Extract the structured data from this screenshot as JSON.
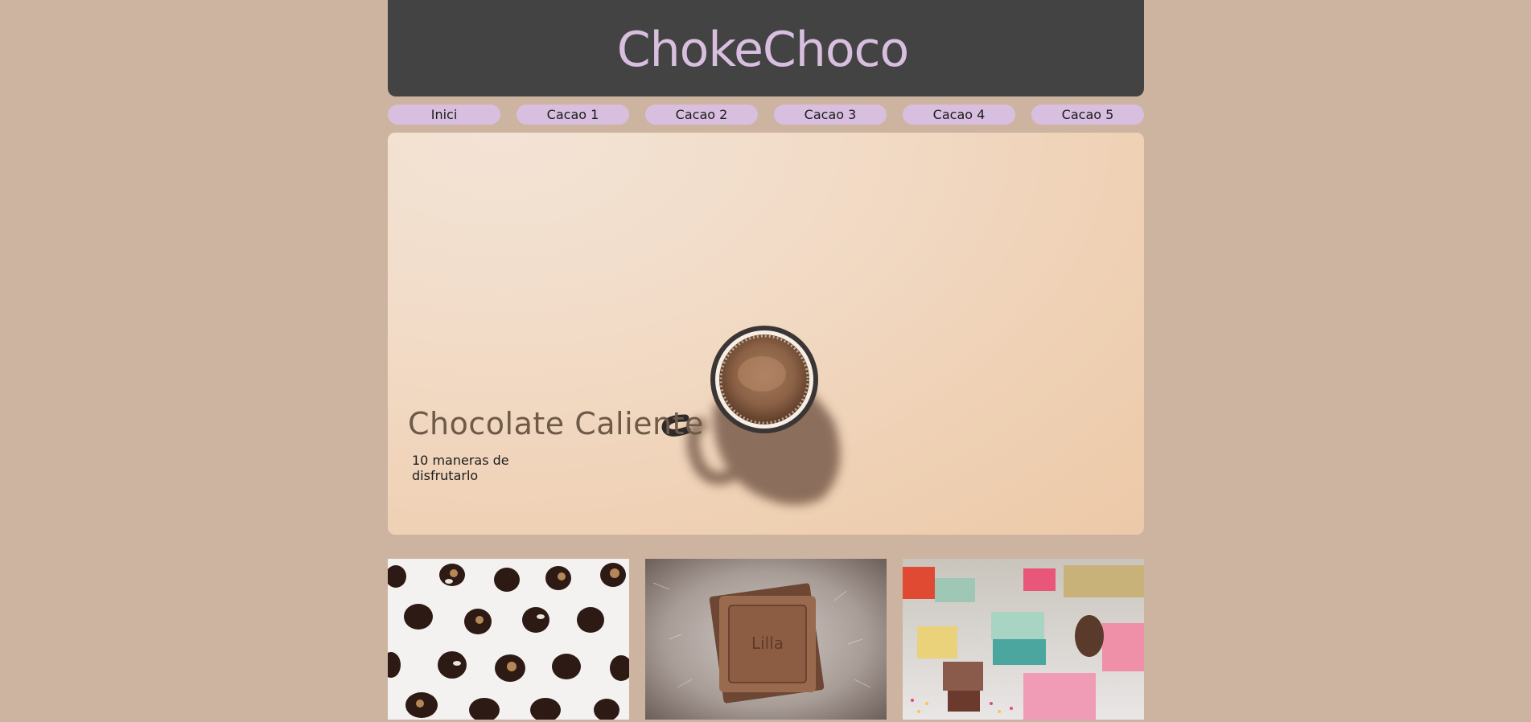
{
  "header": {
    "title": "ChokeChoco"
  },
  "nav": {
    "items": [
      {
        "label": "Inici"
      },
      {
        "label": "Cacao 1"
      },
      {
        "label": "Cacao 2"
      },
      {
        "label": "Cacao 3"
      },
      {
        "label": "Cacao 4"
      },
      {
        "label": "Cacao 5"
      }
    ]
  },
  "hero": {
    "title": "Chocolate Caliente",
    "subtitle": "10 maneras de disfrutarlo"
  },
  "colors": {
    "background": "#cdb4a0",
    "header": "#434343",
    "accent": "#d9bfdf",
    "hero_title": "#6e5a48"
  }
}
